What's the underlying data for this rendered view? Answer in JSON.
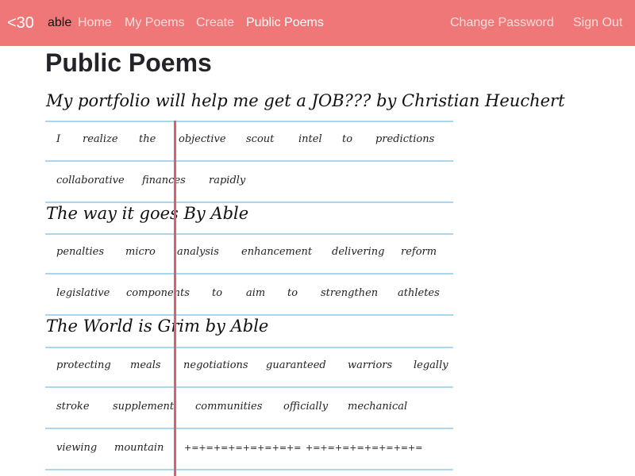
{
  "nav": {
    "brand": "<30",
    "username": "able",
    "links": [
      "Home",
      "My Poems",
      "Create",
      "Public Poems"
    ],
    "right_links": [
      "Change Password",
      "Sign Out"
    ]
  },
  "page": {
    "title": "Public Poems"
  },
  "poems": [
    {
      "title": "My portfolio will help me get a JOB??? by Christian Heuchert",
      "rows": [
        [
          "I",
          "realize",
          "the",
          "objective",
          "scout",
          "intel",
          "to",
          "predictions"
        ],
        [
          "collaborative",
          "finances",
          "rapidly"
        ]
      ]
    },
    {
      "title": "The way it goes By Able",
      "rows": [
        [
          "penalties",
          "micro",
          "analysis",
          "enhancement",
          "delivering",
          "reform"
        ],
        [
          "legislative",
          "components",
          "to",
          "aim",
          "to",
          "strengthen",
          "athletes"
        ]
      ]
    },
    {
      "title": "The World is Grim by Able",
      "rows": [
        [
          "protecting",
          "meals",
          "negotiations",
          "guaranteed",
          "warriors",
          "legally"
        ],
        [
          "stroke",
          "supplement",
          "communities",
          "officially",
          "mechanical"
        ],
        [
          "viewing",
          "mountain",
          "+=+=+=+=+=+=+=+=",
          "+=+=+=+=+=+=+=+="
        ]
      ]
    }
  ],
  "colors": {
    "navbar": "#ef7777",
    "ruled_line": "#a9d7ee",
    "margin_line": "#d9616e"
  }
}
